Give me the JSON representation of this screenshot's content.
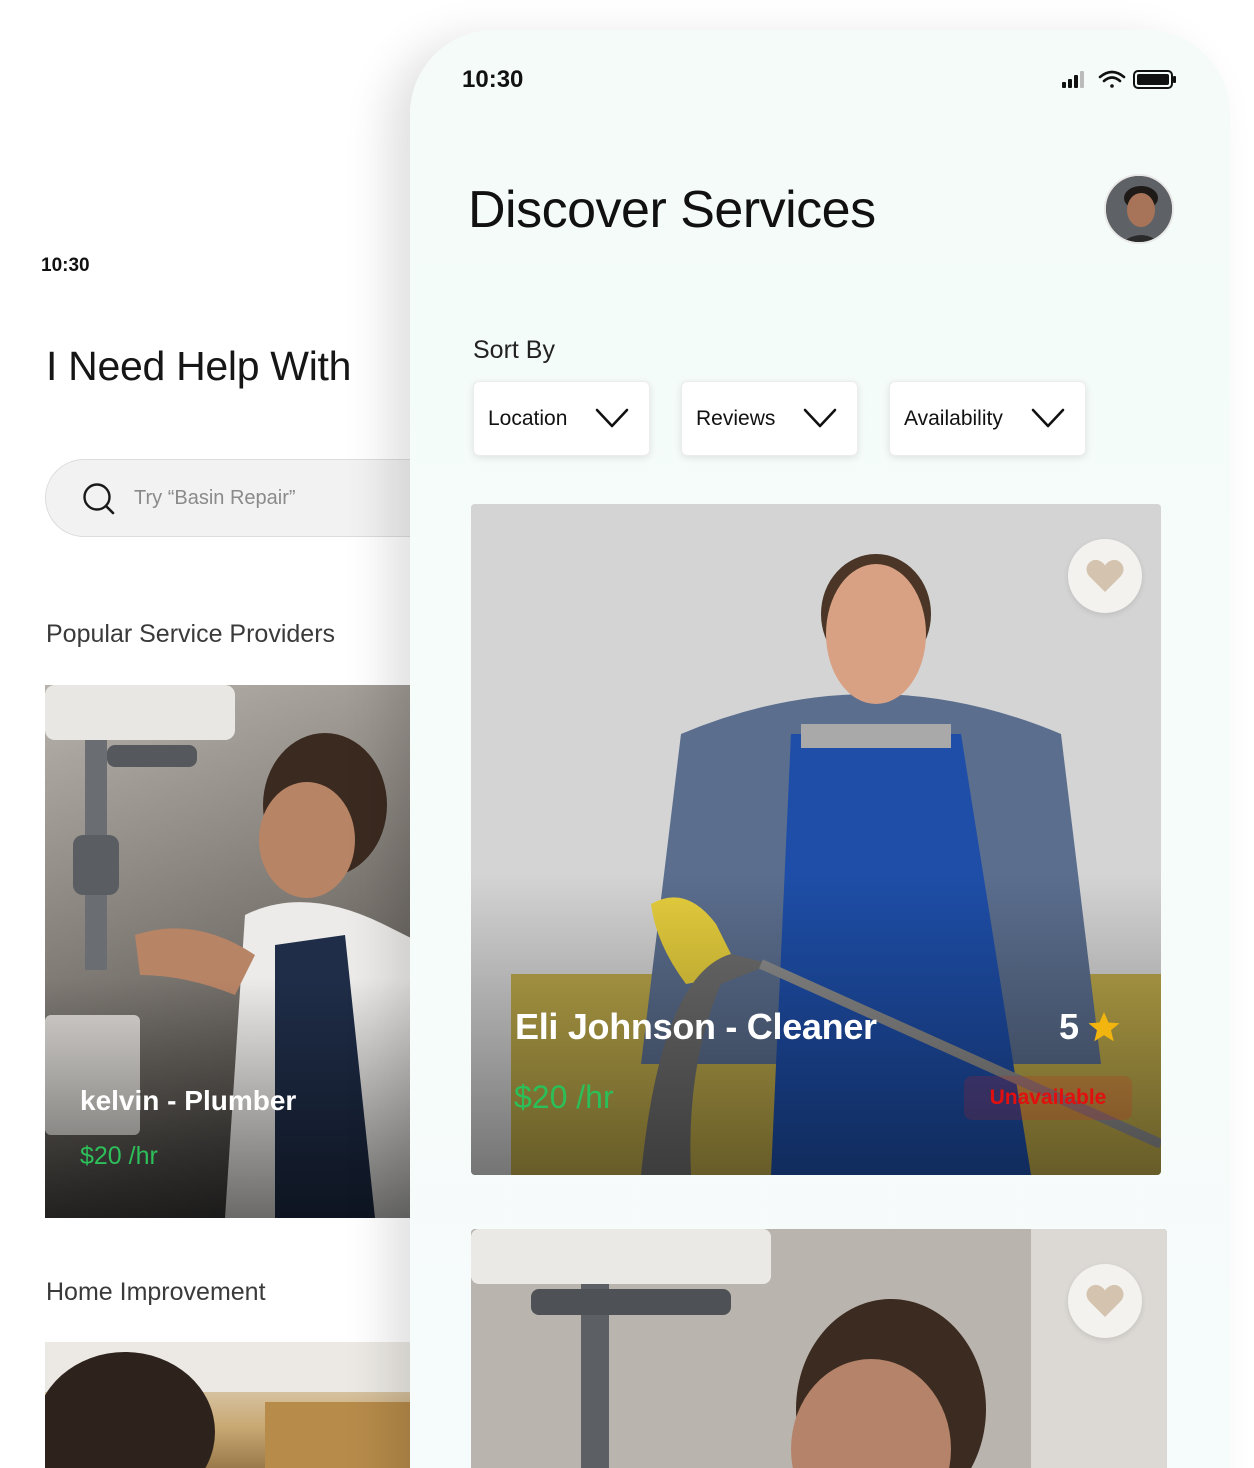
{
  "back_screen": {
    "status_time": "10:30",
    "title": "I Need Help With",
    "search": {
      "placeholder": "Try “Basin Repair”"
    },
    "section_popular": "Popular Service Providers",
    "featured_provider": {
      "name": "kelvin - Plumber",
      "price": "$20 /hr"
    },
    "section_home": "Home Improvement"
  },
  "front_screen": {
    "status_time": "10:30",
    "title": "Discover Services",
    "sort_label": "Sort By",
    "filters": [
      {
        "label": "Location"
      },
      {
        "label": "Reviews"
      },
      {
        "label": "Availability"
      }
    ],
    "providers": [
      {
        "name": "Eli Johnson - Cleaner",
        "rating": "5",
        "price": "$20 /hr",
        "status": "Unavailable",
        "favorite": false
      },
      {
        "name": "",
        "favorite": false
      }
    ]
  },
  "colors": {
    "price_green": "#2bbf59",
    "unavailable_red": "#e20f0f",
    "star_yellow": "#f2b40f",
    "heart_tan": "#d4c3ae",
    "phone_bg": "#f5fcfa"
  },
  "icons": [
    "search-icon",
    "chevron-down-icon",
    "heart-icon",
    "star-icon",
    "signal-icon",
    "wifi-icon",
    "battery-icon"
  ]
}
